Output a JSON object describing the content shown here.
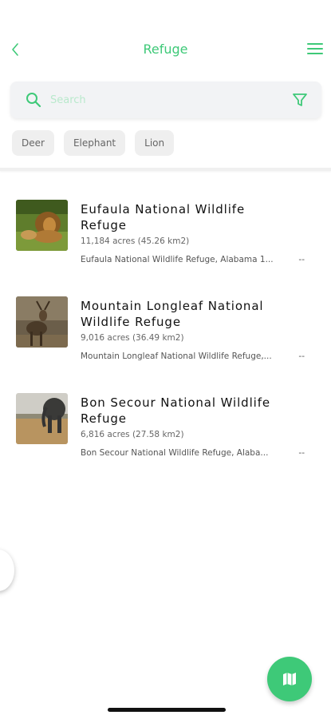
{
  "header": {
    "title": "Refuge",
    "back_icon": "chevron-left-icon",
    "menu_icon": "hamburger-menu-icon"
  },
  "search": {
    "placeholder": "Search",
    "value": "",
    "search_icon": "search-icon",
    "filter_icon": "filter-icon"
  },
  "chips": [
    {
      "label": "Deer"
    },
    {
      "label": "Elephant"
    },
    {
      "label": "Lion"
    }
  ],
  "refuges": [
    {
      "title": "Eufaula National Wildlife Refuge",
      "area": "11,184 acres (45.26 km2)",
      "location": "Eufaula National Wildlife Refuge, Alabama 1...",
      "more": "--",
      "image": "lion-photo"
    },
    {
      "title": "Mountain Longleaf National Wildlife Refuge",
      "area": "9,016 acres (36.49 km2)",
      "location": "Mountain Longleaf National Wildlife Refuge,...",
      "more": "--",
      "image": "deer-photo"
    },
    {
      "title": "Bon Secour National Wildlife Refuge",
      "area": "6,816 acres (27.58 km2)",
      "location": "Bon Secour National Wildlife Refuge, Alaba...",
      "more": "--",
      "image": "elephant-photo"
    }
  ],
  "fab": {
    "icon": "map-icon"
  },
  "colors": {
    "accent": "#3ec978",
    "chip_bg": "#efefef",
    "search_bg": "#f2f3f5"
  }
}
